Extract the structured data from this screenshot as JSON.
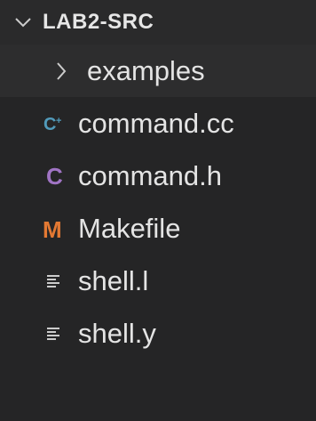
{
  "explorer": {
    "root_title": "LAB2-SRC",
    "root_icon": "chevron-down-icon",
    "items": [
      {
        "label": "examples",
        "kind": "folder",
        "icon": "chevron-right-icon",
        "expanded": false
      },
      {
        "label": "command.cc",
        "kind": "file",
        "icon": "cpp-file-icon",
        "color": "#519aba"
      },
      {
        "label": "command.h",
        "kind": "file",
        "icon": "c-header-file-icon",
        "color": "#a074c4"
      },
      {
        "label": "Makefile",
        "kind": "file",
        "icon": "makefile-icon",
        "color": "#e37933"
      },
      {
        "label": "shell.l",
        "kind": "file",
        "icon": "text-file-icon",
        "color": "#cccccc"
      },
      {
        "label": "shell.y",
        "kind": "file",
        "icon": "text-file-icon",
        "color": "#cccccc"
      }
    ]
  },
  "colors": {
    "background": "#252526",
    "text": "#e4e4e4"
  }
}
